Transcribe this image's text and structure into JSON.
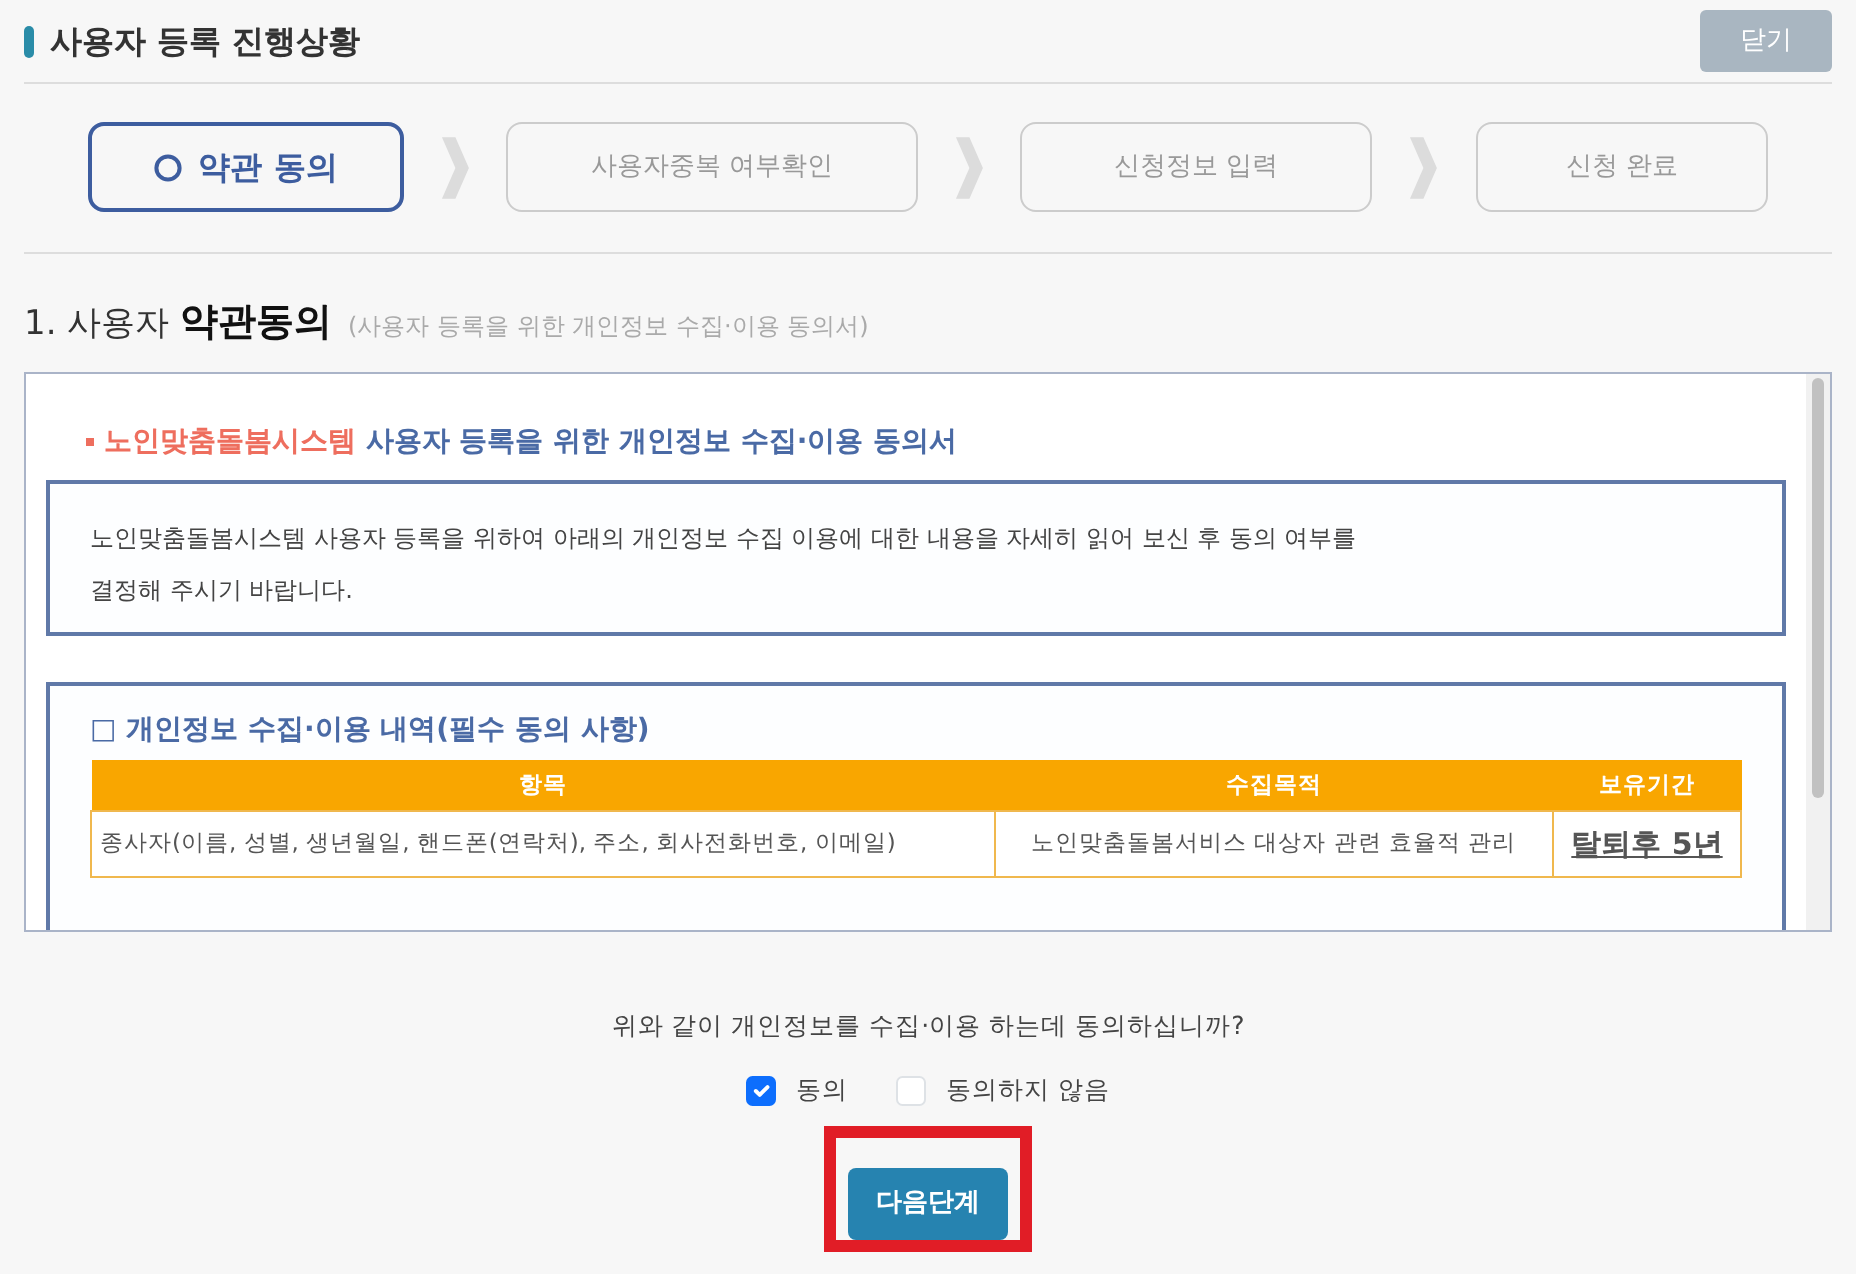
{
  "header": {
    "title": "사용자 등록 진행상황",
    "close_button": "닫기"
  },
  "steps": [
    {
      "label": "약관 동의",
      "selected": true
    },
    {
      "label": "사용자중복 여부확인",
      "selected": false
    },
    {
      "label": "신청정보 입력",
      "selected": false
    },
    {
      "label": "신청 완료",
      "selected": false
    }
  ],
  "section": {
    "title": "1. 사용자 **약관동의**",
    "subtitle": "(사용자 등록을 위한 개인정보 수집·이용 동의서)"
  },
  "agreement": {
    "heading_highlight": "노인맞춤돌봄시스템",
    "heading": "사용자 등록을 위한 개인정보 수집·이용 동의서",
    "intro": "노인맞춤돌봄시스템 사용자 등록을 위하여 아래의 개인정보 수집 이용에 대한 내용을 자세히 읽어 보신 후 동의 여부를 결정해 주시기 바랍니다.",
    "details_title": "□ 개인정보 수집·이용 내역(필수 동의 사항)",
    "table": {
      "columns": [
        "항목",
        "수집목적",
        "보유기간"
      ],
      "rows": [
        [
          "종사자(이름, 성별, 생년월일, 핸드폰(연락처), 주소, 회사전화번호, 이메일)",
          "노인맞춤돌봄서비스 대상자 관련 효율적 관리",
          "탈퇴후 5년"
        ]
      ]
    }
  },
  "question": "위와 같이 개인정보를 수집·이용 하는데 동의하십니까?",
  "options": [
    {
      "label": "동의",
      "checked": true
    },
    {
      "label": "동의하지 않음",
      "checked": false
    }
  ],
  "next_button": {
    "label": "다음단계",
    "highlighted": true
  }
}
